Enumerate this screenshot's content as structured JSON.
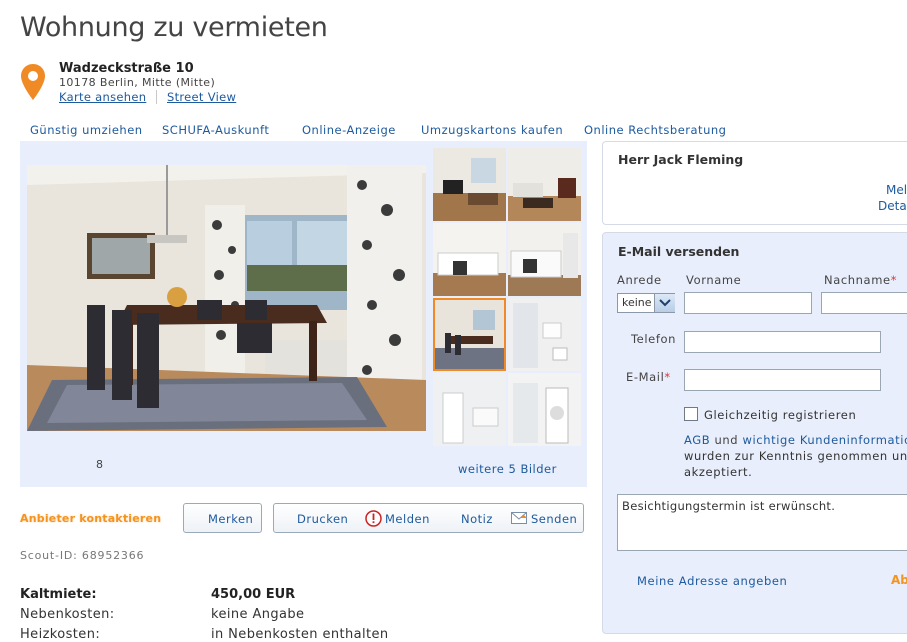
{
  "page": {
    "title": "Wohnung zu vermieten"
  },
  "address": {
    "street": "Wadzeckstraße 10",
    "city": "10178 Berlin, Mitte (Mitte)",
    "map_link": "Karte ansehen",
    "street_view_link": "Street View"
  },
  "nav": [
    "Günstig umziehen",
    "SCHUFA-Auskunft",
    "Online-Anzeige",
    "Umzugskartons kaufen",
    "Online Rechtsberatung"
  ],
  "gallery": {
    "counter": "8",
    "more_link": "weitere 5 Bilder",
    "thumbnails": [
      "living-room-1",
      "living-room-2",
      "kitchen-1",
      "kitchen-2",
      "dining-room",
      "bathroom-1",
      "bathroom-2",
      "bathroom-3"
    ],
    "selected_thumbnail": 4
  },
  "actions": {
    "contact": "Anbieter kontaktieren",
    "bookmark": "Merken",
    "print": "Drucken",
    "report": "Melden",
    "note": "Notiz",
    "send": "Senden"
  },
  "scout_id": "Scout-ID: 68952366",
  "costs": [
    {
      "label": "Kaltmiete:",
      "value": "450,00 EUR",
      "bold": true
    },
    {
      "label": "Nebenkosten:",
      "value": "keine Angabe",
      "bold": false
    },
    {
      "label": "Heizkosten:",
      "value": "in Nebenkosten enthalten",
      "bold": false
    }
  ],
  "agent": {
    "name": "Herr Jack Fleming",
    "more_link": "Mel",
    "details_link": "Deta"
  },
  "email_form": {
    "title": "E-Mail versenden",
    "salutation_label": "Anrede",
    "salutation_value": "keine",
    "firstname_label": "Vorname",
    "lastname_label": "Nachname",
    "phone_label": "Telefon",
    "email_label": "E-Mail",
    "register_label": "Gleichzeitig registrieren",
    "terms_agb": "AGB",
    "terms_and": "und",
    "terms_info_link": "wichtige Kundeninformatio",
    "terms_line2": "wurden zur Kenntnis genommen und",
    "terms_line3": "akzeptiert.",
    "message": "Besichtigungstermin ist erwünscht.",
    "address_link": "Meine Adresse angeben",
    "submit_partial": "Ab"
  },
  "colors": {
    "link": "#1d5a9e",
    "accent": "#f5931f",
    "panel": "#e8eefb",
    "required": "#dd3333"
  }
}
